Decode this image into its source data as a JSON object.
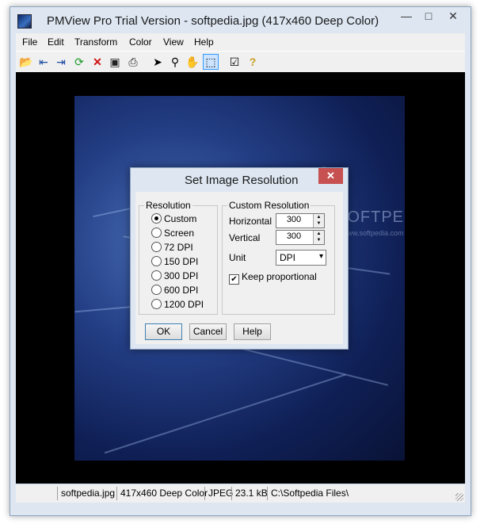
{
  "window": {
    "title": "PMView Pro Trial Version - softpedia.jpg (417x460 Deep Color)"
  },
  "caption_buttons": {
    "minimize": "—",
    "maximize": "□",
    "close": "✕"
  },
  "menubar": {
    "items": [
      "File",
      "Edit",
      "Transform",
      "Color",
      "View",
      "Help"
    ]
  },
  "toolbar": {
    "icons": [
      "open-folder-icon",
      "previous-file-icon",
      "next-file-icon",
      "refresh-icon",
      "delete-icon",
      "save-icon",
      "print-icon",
      "pointer-icon",
      "zoom-icon",
      "hand-icon",
      "select-rectangle-icon",
      "properties-icon",
      "help-icon"
    ]
  },
  "image": {
    "watermark": "SOFTPEDIA",
    "watermark_sub": "www.softpedia.com"
  },
  "dialog": {
    "title": "Set Image Resolution",
    "close": "✕",
    "resolution_group": "Resolution",
    "resolution_options": [
      "Custom",
      "Screen",
      "72 DPI",
      "150 DPI",
      "300 DPI",
      "600 DPI",
      "1200 DPI"
    ],
    "selected_option": "Custom",
    "custom_group": "Custom Resolution",
    "horizontal_label": "Horizontal",
    "horizontal_value": "300",
    "vertical_label": "Vertical",
    "vertical_value": "300",
    "unit_label": "Unit",
    "unit_value": "DPI",
    "keep_proportional_label": "Keep proportional",
    "keep_proportional_checked": true,
    "ok": "OK",
    "cancel": "Cancel",
    "help": "Help"
  },
  "statusbar": {
    "filename": "softpedia.jpg",
    "dimensions": "417x460 Deep Color",
    "format": "JPEG",
    "size": "23.1 kB",
    "path": "C:\\Softpedia Files\\"
  },
  "colors": {
    "chrome": "#dde6f1",
    "close_red": "#c75050",
    "canvas": "#000000"
  }
}
